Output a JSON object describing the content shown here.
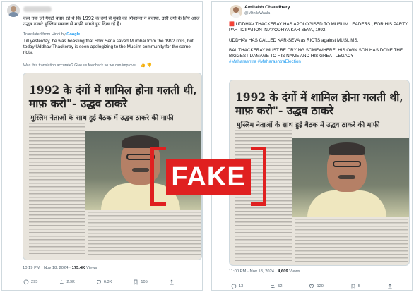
{
  "left_post": {
    "hindi_text": "कल तक जो गैंगटी बघार रहे थे कि 1992 के दंगों से मुंबई को शिवसेना ने बचाया, उसी दंगों के लिए आज उद्धव ठाकरे मुस्लिम समाज से माफ़ी मांगते हुए दिख रहे है।",
    "translated_label": "Translated from Hindi by",
    "translated_by": "Google",
    "english_text": "Till yesterday, he was boasting that Shiv Sena saved Mumbai from the 1992 riots, but today Uddhav Thackeray is seen apologizing to the Muslim community for the same riots.",
    "feedback": "Was this translation accurate? Give us feedback so we can improve:",
    "feedback_icons": "👍 👎",
    "image": {
      "headline": "1992 के दंगों में शामिल होना गलती थी, माफ़ करो\"- उद्धव ठाकरे",
      "subhead": "मुस्लिम नेताओं के साथ हुई बैठक में उद्धव ठाकरे की माफी"
    },
    "time": "10:19 PM · Nov 18, 2024 · ",
    "views": "175.4K",
    "views_label": " Views",
    "actions": {
      "replies": "295",
      "reposts": "2.9K",
      "likes": "6.3K",
      "bookmarks": "105"
    }
  },
  "right_post": {
    "name": "Amitabh Chaudhary",
    "handle": "@MithilaWaala",
    "para1": "🟥 UDDHAV THACKERAY HAS APOLOGISED TO MUSLIM LEADERS , FOR HIS PARTY PARTICIPATION IN AYODHYA KAR-SEVA, 1992.",
    "para2": "UDDHAV HAS CALLED KAR-SEVA as RIOTS against MUSLIMS.",
    "para3": "BAL THACKERAY MUST BE CRYING SOMEWHERE, HIS OWN SON HAS DONE THE BIGGEST DAMAGE TO HIS NAME AND HIS GREAT LEGACY",
    "hashtags": "#Maharashtra #MaharashtraElection",
    "image": {
      "headline": "1992 के दंगों में शामिल होना गलती थी, माफ़ करो\"- उद्धव ठाकरे",
      "subhead": "मुस्लिम नेताओं के साथ हुई बैठक में उद्धव ठाकरे की माफी"
    },
    "time": "11:00 PM · Nov 18, 2024 · ",
    "views": "4,609",
    "views_label": " Views",
    "actions": {
      "replies": "13",
      "reposts": "52",
      "likes": "120",
      "bookmarks": "5"
    }
  },
  "stamp": {
    "label": "FAKE",
    "color": "#e02020"
  }
}
